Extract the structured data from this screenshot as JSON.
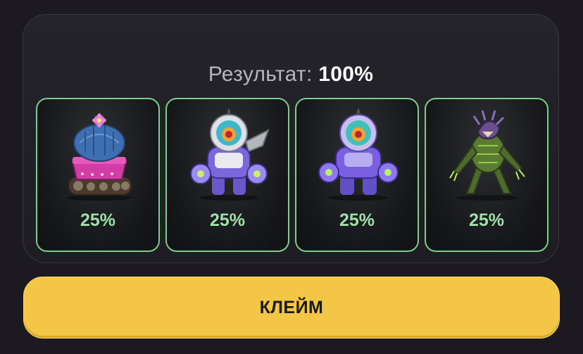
{
  "result": {
    "label": "Результат:",
    "value": "100%"
  },
  "cards": [
    {
      "icon": "cactus-tank-icon",
      "percent": "25%"
    },
    {
      "icon": "purple-robot-winged-icon",
      "percent": "25%"
    },
    {
      "icon": "purple-robot-icon",
      "percent": "25%"
    },
    {
      "icon": "green-monster-icon",
      "percent": "25%"
    }
  ],
  "claim_button": {
    "label": "КЛЕЙМ"
  },
  "colors": {
    "accent": "#f3c745",
    "card_border": "#7ccf86",
    "percent_text": "#9fe0a8",
    "background": "#1c1a20"
  }
}
